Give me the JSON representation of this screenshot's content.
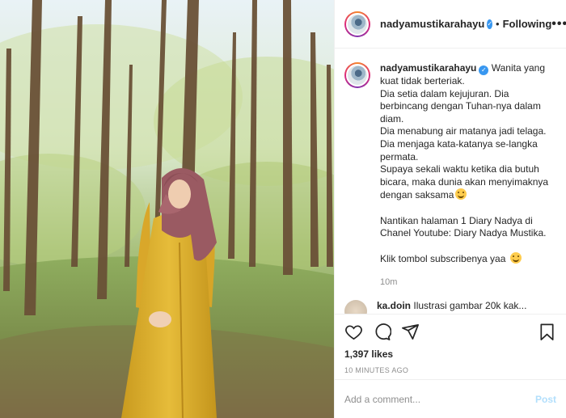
{
  "header": {
    "username": "nadyamustikarahayu",
    "separator": "•",
    "follow_status": "Following",
    "more": "•••",
    "verified": true
  },
  "caption": {
    "username": "nadyamustikarahayu",
    "lines": [
      "Wanita yang kuat tidak berteriak.",
      "Dia setia dalam kejujuran. Dia berbincang dengan Tuhan-nya dalam diam.",
      "Dia menabung air matanya jadi telaga.",
      "Dia menjaga kata-katanya se-langka permata.",
      "Supaya sekali waktu ketika dia butuh bicara, maka dunia akan menyimaknya dengan saksama",
      "",
      "Nantikan halaman 1 Diary Nadya di Chanel Youtube: Diary Nadya Mustika.",
      "",
      "Klik tombol subscribenya yaa"
    ],
    "time": "10m"
  },
  "comment": {
    "username": "ka.doin",
    "text": "Ilustrasi gambar 20k kak..."
  },
  "actions": {
    "likes": "1,397 likes",
    "posted_ago": "10 MINUTES AGO"
  },
  "add_comment": {
    "placeholder": "Add a comment...",
    "post_label": "Post"
  },
  "colors": {
    "verified": "#3897f0",
    "post_disabled": "#b2dffc",
    "dress": "#e0b431",
    "hijab": "#9a5a62"
  },
  "icons": [
    "heart-icon",
    "comment-icon",
    "share-icon",
    "bookmark-icon",
    "verified-icon",
    "more-icon"
  ]
}
